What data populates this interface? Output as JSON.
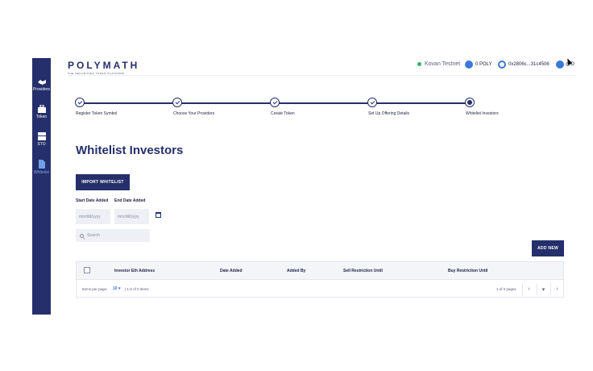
{
  "sidebar": {
    "items": [
      {
        "label": "Providers",
        "icon": "handshake-icon"
      },
      {
        "label": "Token",
        "icon": "briefcase-icon"
      },
      {
        "label": "STO",
        "icon": "cash-register-icon"
      },
      {
        "label": "Whitelist",
        "icon": "document-icon",
        "active": true
      }
    ]
  },
  "header": {
    "logo": "POLYMATH",
    "tagline": "THE SECURITIES TOKEN PLATFORM",
    "network": "Kovan Testnet",
    "balance": "0 POLY",
    "address": "0x2806c...31c4506",
    "user_label": "@O"
  },
  "stepper": {
    "steps": [
      {
        "label": "Register Token Symbol",
        "state": "done"
      },
      {
        "label": "Choose Your Providers",
        "state": "done"
      },
      {
        "label": "Create Token",
        "state": "done"
      },
      {
        "label": "Set Up Offering Details",
        "state": "done"
      },
      {
        "label": "Whitelist Investors",
        "state": "current"
      }
    ]
  },
  "main": {
    "title": "Whitelist Investors",
    "import_button": "IMPORT WHITELIST",
    "start_date_label": "Start Date Added",
    "end_date_label": "End Date Added",
    "start_date_placeholder": "mm/dd/yyyy",
    "end_date_placeholder": "mm/dd/yyyy",
    "search_placeholder": "Search",
    "add_button": "ADD NEW"
  },
  "table": {
    "columns": [
      "Investor Eth Address",
      "Date Added",
      "Added By",
      "Sell Restriction Until",
      "Buy Restriction Until"
    ],
    "items_per_page_label": "Items per page:",
    "items_per_page": "10 ▾",
    "range": "| 1-0 of 0 items",
    "pages": "1 of 0 pages",
    "prev": "‹",
    "page_select": "▾",
    "next": "›"
  },
  "colors": {
    "primary": "#252f6b",
    "accent": "#3b78d8",
    "network_status": "#2fb36b"
  }
}
